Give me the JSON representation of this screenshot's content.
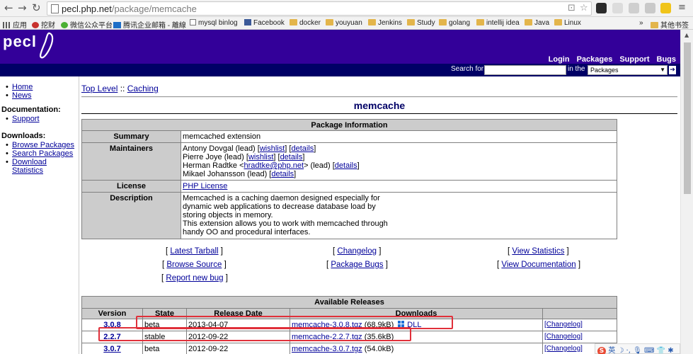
{
  "browser": {
    "url_host": "pecl.php.net",
    "url_path": "/package/memcache",
    "bookmarks": [
      {
        "label": "应用",
        "icon": "apps-grid-icon"
      },
      {
        "label": "挖财",
        "icon": "wacai-icon"
      },
      {
        "label": "微信公众平台",
        "icon": "wechat-icon"
      },
      {
        "label": "腾讯企业邮箱 - 離線",
        "icon": "tencent-mail-icon"
      },
      {
        "label": "mysql binlog",
        "icon": "page-icon"
      },
      {
        "label": "Facebook",
        "icon": "facebook-icon"
      },
      {
        "label": "docker",
        "icon": "folder-icon"
      },
      {
        "label": "youyuan",
        "icon": "folder-icon"
      },
      {
        "label": "Jenkins",
        "icon": "folder-icon"
      },
      {
        "label": "Study",
        "icon": "folder-icon"
      },
      {
        "label": "golang",
        "icon": "folder-icon"
      },
      {
        "label": "intellij idea",
        "icon": "folder-icon"
      },
      {
        "label": "Java",
        "icon": "folder-icon"
      },
      {
        "label": "Linux",
        "icon": "folder-icon"
      }
    ],
    "more_bookmarks": "»",
    "other_bookmarks": "其他书签"
  },
  "header": {
    "logo": "pecl",
    "nav": [
      "Login",
      "Packages",
      "Support",
      "Bugs"
    ],
    "search_for_label": "Search for",
    "search_value": "",
    "in_the_label": "in the",
    "search_scope": "Packages"
  },
  "sidebar": {
    "top_links": [
      "Home",
      "News"
    ],
    "documentation_heading": "Documentation:",
    "documentation_links": [
      "Support"
    ],
    "downloads_heading": "Downloads:",
    "downloads_links": [
      "Browse Packages",
      "Search Packages",
      "Download Statistics"
    ]
  },
  "breadcrumb": {
    "top_level": "Top Level",
    "separator": "::",
    "category": "Caching"
  },
  "package": {
    "name": "memcache",
    "info_caption": "Package Information",
    "summary_label": "Summary",
    "summary": "memcached extension",
    "maintainers_label": "Maintainers",
    "maintainers": [
      {
        "pre": "Antony Dovgal (lead) [",
        "l1": "wishlist",
        "mid": "] [",
        "l2": "details",
        "post": "]"
      },
      {
        "pre": "Pierre Joye (lead) [",
        "l1": "wishlist",
        "mid": "] [",
        "l2": "details",
        "post": "]"
      },
      {
        "pre": "Herman Radtke <",
        "l1": "hradtke@php.net",
        "mid": "> (lead) [",
        "l2": "details",
        "post": "]"
      },
      {
        "pre": "Mikael Johansson (lead) [",
        "l1": "",
        "mid": "",
        "l2": "details",
        "post": "]"
      }
    ],
    "license_label": "License",
    "license": "PHP License",
    "description_label": "Description",
    "description_lines": [
      "Memcached is a caching daemon designed especially for",
      "dynamic web applications to decrease database load by",
      "storing objects in memory.",
      "This extension allows you to work with memcached through",
      "handy OO and procedural interfaces."
    ]
  },
  "links": {
    "latest_tarball": "Latest Tarball",
    "changelog": "Changelog",
    "view_statistics": "View Statistics",
    "browse_source": "Browse Source",
    "package_bugs": "Package Bugs",
    "view_documentation": "View Documentation",
    "report_new_bug": "Report new bug"
  },
  "releases": {
    "caption": "Available Releases",
    "columns": [
      "Version",
      "State",
      "Release Date",
      "Downloads",
      ""
    ],
    "rows": [
      {
        "version": "3.0.8",
        "state": "beta",
        "date": "2013-04-07",
        "file": "memcache-3.0.8.tgz",
        "size": "(68.9kB)",
        "dll": "DLL",
        "changelog": "[Changelog]"
      },
      {
        "version": "2.2.7",
        "state": "stable",
        "date": "2012-09-22",
        "file": "memcache-2.2.7.tgz",
        "size": "(35.6kB)",
        "dll": "",
        "changelog": "[Changelog]"
      },
      {
        "version": "3.0.7",
        "state": "beta",
        "date": "2012-09-22",
        "file": "memcache-3.0.7.tgz",
        "size": "(54.0kB)",
        "dll": "",
        "changelog": "[Changelog]"
      }
    ]
  },
  "tray": {
    "ime": "英"
  },
  "colors": {
    "header_purple": "#330099",
    "search_strip": "#000066",
    "link": "#000099",
    "highlight": "#e0303a",
    "table_header": "#cccccc"
  }
}
